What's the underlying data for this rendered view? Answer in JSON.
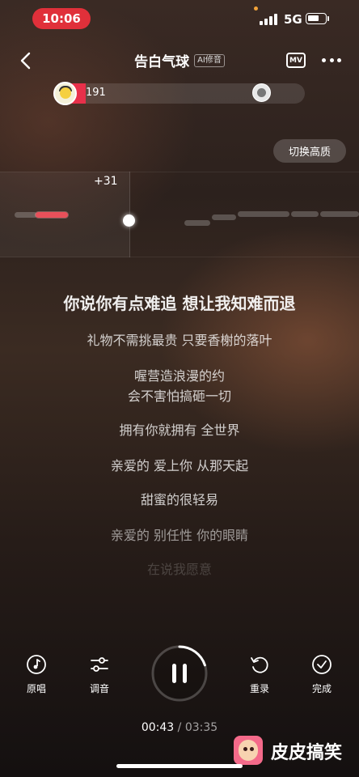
{
  "status_bar": {
    "time": "10:06",
    "network": "5G"
  },
  "header": {
    "title": "告白气球",
    "tag": "AI修音",
    "mv_label": "MV"
  },
  "score": {
    "value": "191"
  },
  "quality_button": "切换高质",
  "pitch": {
    "bonus": "+31"
  },
  "lyrics": [
    "你说你有点难追 想让我知难而退",
    "礼物不需挑最贵 只要香榭的落叶",
    "喔营造浪漫的约",
    "会不害怕搞砸一切",
    "拥有你就拥有 全世界",
    "亲爱的 爱上你 从那天起",
    "甜蜜的很轻易",
    "亲爱的 别任性 你的眼睛",
    "在说我愿意"
  ],
  "controls": {
    "original": "原唱",
    "tune": "调音",
    "restart": "重录",
    "finish": "完成"
  },
  "progress": {
    "current": "00:43",
    "separator": "/",
    "total": "03:35",
    "fraction": 0.2
  },
  "watermark": "皮皮搞笑",
  "colors": {
    "accent": "#e8304a",
    "status_pill": "#e0303a"
  }
}
